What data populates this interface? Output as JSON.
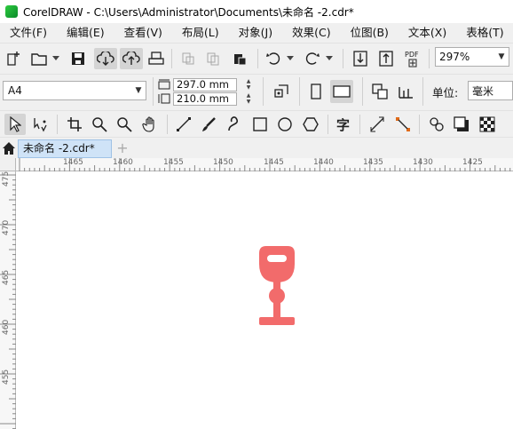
{
  "window": {
    "title": "CorelDRAW - C:\\Users\\Administrator\\Documents\\未命名 -2.cdr*"
  },
  "menu": [
    "文件(F)",
    "编辑(E)",
    "查看(V)",
    "布局(L)",
    "对象(J)",
    "效果(C)",
    "位图(B)",
    "文本(X)",
    "表格(T)"
  ],
  "toolbar": {
    "zoom": "297%"
  },
  "property_bar": {
    "page_size": "A4",
    "width": "297.0 mm",
    "height": "210.0 mm",
    "units_label": "单位:",
    "units_value": "毫米"
  },
  "tabs": {
    "document": "未命名 -2.cdr*",
    "add": "+"
  },
  "rulers": {
    "horizontal": [
      "1465",
      "1460",
      "1455",
      "1450",
      "1445",
      "1440",
      "1435",
      "1430",
      "1425"
    ],
    "vertical": [
      "475",
      "470",
      "465",
      "460",
      "455"
    ]
  },
  "colors": {
    "glass": "#f26b6b",
    "tab_active": "#cfe3f7"
  }
}
